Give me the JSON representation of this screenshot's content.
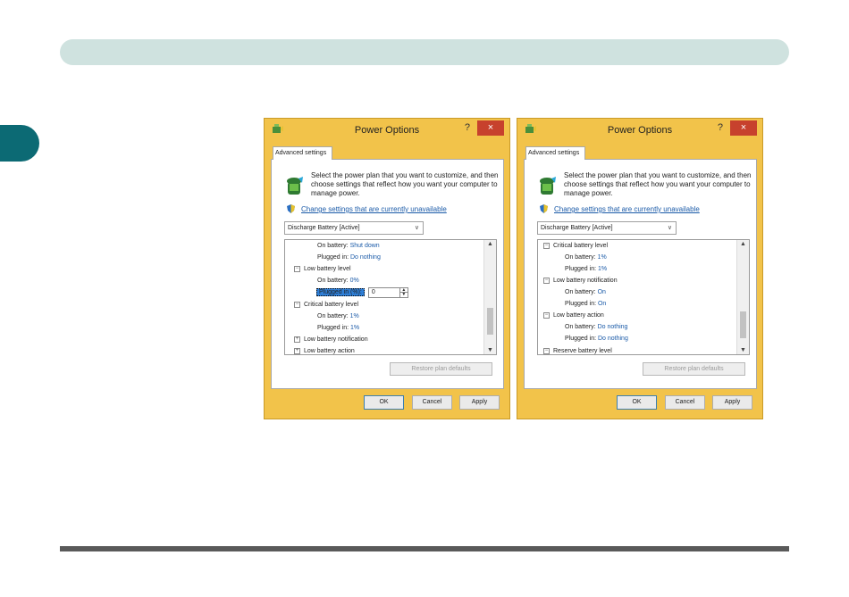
{
  "page": {
    "side_marker_color": "#0c6a74",
    "top_band_color": "#cfe2df"
  },
  "dialogs": [
    {
      "title": "Power Options",
      "help": "?",
      "close": "×",
      "tab": "Advanced settings",
      "description": "Select the power plan that you want to customize, and then choose settings that reflect how you want your computer to manage power.",
      "link": "Change settings that are currently unavailable",
      "plan": "Discharge Battery [Active]",
      "tree": {
        "r0k": "On battery:",
        "r0v": "Shut down",
        "r1k": "Plugged in:",
        "r1v": "Do nothing",
        "r2": "Low battery level",
        "r3k": "On battery:",
        "r3v": "0%",
        "r4k": "Plugged in (%):",
        "r4v": "0",
        "r5": "Critical battery level",
        "r6k": "On battery:",
        "r6v": "1%",
        "r7k": "Plugged in:",
        "r7v": "1%",
        "r8": "Low battery notification",
        "r9": "Low battery action"
      },
      "restore": "Restore plan defaults",
      "ok": "OK",
      "cancel": "Cancel",
      "apply": "Apply"
    },
    {
      "title": "Power Options",
      "help": "?",
      "close": "×",
      "tab": "Advanced settings",
      "description": "Select the power plan that you want to customize, and then choose settings that reflect how you want your computer to manage power.",
      "link": "Change settings that are currently unavailable",
      "plan": "Discharge Battery [Active]",
      "tree": {
        "r0": "Critical battery level",
        "r1k": "On battery:",
        "r1v": "1%",
        "r2k": "Plugged in:",
        "r2v": "1%",
        "r3": "Low battery notification",
        "r4k": "On battery:",
        "r4v": "On",
        "r5k": "Plugged in:",
        "r5v": "On",
        "r6": "Low battery action",
        "r7k": "On battery:",
        "r7v": "Do nothing",
        "r8k": "Plugged in:",
        "r8v": "Do nothing",
        "r9": "Reserve battery level"
      },
      "restore": "Restore plan defaults",
      "ok": "OK",
      "cancel": "Cancel",
      "apply": "Apply"
    }
  ]
}
